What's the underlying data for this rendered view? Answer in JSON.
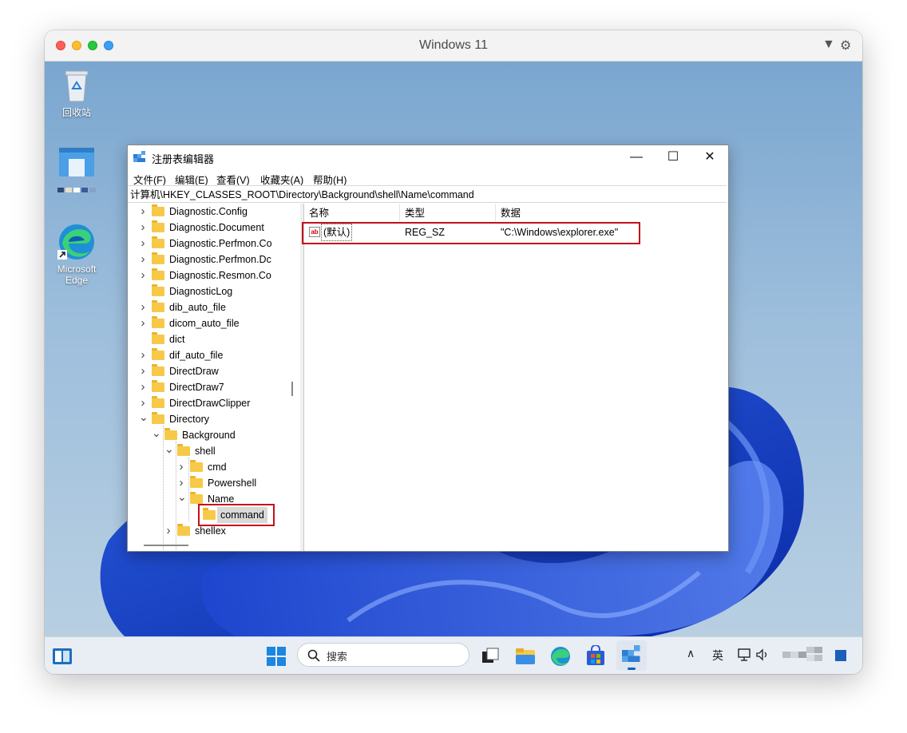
{
  "mac": {
    "title": "Windows 11"
  },
  "desktop": {
    "icons": [
      {
        "label": "回收站"
      },
      {
        "label": "Microsoft Edge"
      }
    ]
  },
  "taskbar": {
    "search_placeholder": "搜索",
    "ime": "英"
  },
  "regedit": {
    "title": "注册表编辑器",
    "menu": [
      "文件(F)",
      "编辑(E)",
      "查看(V)",
      "收藏夹(A)",
      "帮助(H)"
    ],
    "address": "计算机\\HKEY_CLASSES_ROOT\\Directory\\Background\\shell\\Name\\command",
    "tree": [
      {
        "label": "Diagnostic.Config",
        "level": 0,
        "expander": "collapsed"
      },
      {
        "label": "Diagnostic.Document",
        "level": 0,
        "expander": "collapsed"
      },
      {
        "label": "Diagnostic.Perfmon.Co",
        "level": 0,
        "expander": "collapsed"
      },
      {
        "label": "Diagnostic.Perfmon.Dc",
        "level": 0,
        "expander": "collapsed"
      },
      {
        "label": "Diagnostic.Resmon.Co",
        "level": 0,
        "expander": "collapsed"
      },
      {
        "label": "DiagnosticLog",
        "level": 0,
        "expander": "none"
      },
      {
        "label": "dib_auto_file",
        "level": 0,
        "expander": "collapsed"
      },
      {
        "label": "dicom_auto_file",
        "level": 0,
        "expander": "collapsed"
      },
      {
        "label": "dict",
        "level": 0,
        "expander": "none"
      },
      {
        "label": "dif_auto_file",
        "level": 0,
        "expander": "collapsed"
      },
      {
        "label": "DirectDraw",
        "level": 0,
        "expander": "collapsed"
      },
      {
        "label": "DirectDraw7",
        "level": 0,
        "expander": "collapsed"
      },
      {
        "label": "DirectDrawClipper",
        "level": 0,
        "expander": "collapsed"
      },
      {
        "label": "Directory",
        "level": 0,
        "expander": "expanded"
      },
      {
        "label": "Background",
        "level": 1,
        "expander": "expanded"
      },
      {
        "label": "shell",
        "level": 2,
        "expander": "expanded"
      },
      {
        "label": "cmd",
        "level": 3,
        "expander": "collapsed"
      },
      {
        "label": "Powershell",
        "level": 3,
        "expander": "collapsed"
      },
      {
        "label": "Name",
        "level": 3,
        "expander": "expanded"
      },
      {
        "label": "command",
        "level": 4,
        "expander": "none",
        "selected": true
      },
      {
        "label": "shellex",
        "level": 2,
        "expander": "collapsed"
      }
    ],
    "columns": {
      "name": "名称",
      "type": "类型",
      "data": "数据"
    },
    "values": [
      {
        "name": "(默认)",
        "type": "REG_SZ",
        "data": "\"C:\\Windows\\explorer.exe\""
      }
    ]
  },
  "colors": {
    "highlight": "#c4101b",
    "accent": "#0067c0"
  }
}
